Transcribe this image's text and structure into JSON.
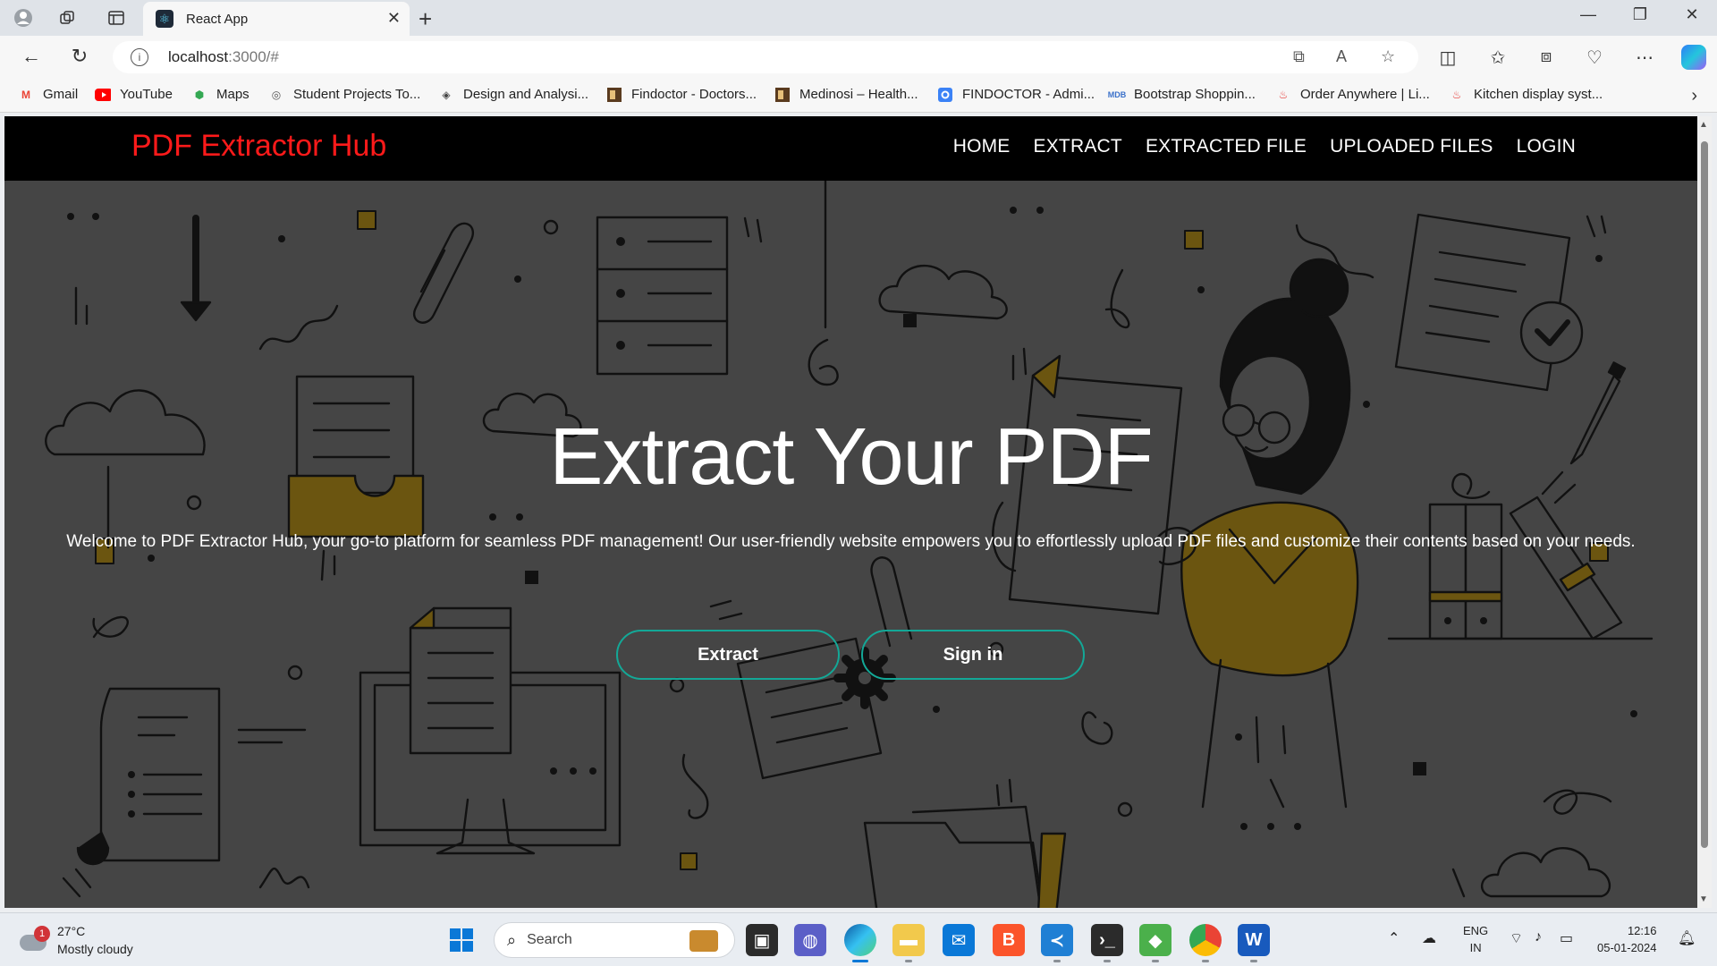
{
  "browser": {
    "tab_title": "React App",
    "url_host": "localhost",
    "url_rest": ":3000/#",
    "bookmarks": [
      {
        "label": "Gmail",
        "icon": "gmail-icon",
        "color": "#ea4335"
      },
      {
        "label": "YouTube",
        "icon": "youtube-icon",
        "color": "#ff0000"
      },
      {
        "label": "Maps",
        "icon": "maps-icon",
        "color": "#34a853"
      },
      {
        "label": "Student Projects To...",
        "icon": "globe-icon",
        "color": "#555555"
      },
      {
        "label": "Design and Analysi...",
        "icon": "diamond-icon",
        "color": "#444444"
      },
      {
        "label": "Findoctor - Doctors...",
        "icon": "site-icon",
        "color": "#5a3b1f"
      },
      {
        "label": "Medinosi – Health...",
        "icon": "site-icon",
        "color": "#5a3b1f"
      },
      {
        "label": "FINDOCTOR - Admi...",
        "icon": "gear-site-icon",
        "color": "#3b82f6"
      },
      {
        "label": "Bootstrap Shoppin...",
        "icon": "mdb-icon",
        "color": "#3b71ca"
      },
      {
        "label": "Order Anywhere | Li...",
        "icon": "flame-icon",
        "color": "#e53935"
      },
      {
        "label": "Kitchen display syst...",
        "icon": "flame-icon",
        "color": "#e53935"
      }
    ]
  },
  "site": {
    "brand": "PDF Extractor Hub",
    "nav": [
      "HOME",
      "EXTRACT",
      "EXTRACTED FILE",
      "UPLOADED FILES",
      "LOGIN"
    ],
    "hero_title": "Extract Your PDF",
    "hero_description": "Welcome to PDF Extractor Hub, your go-to platform for seamless PDF management! Our user-friendly website empowers you to effortlessly upload PDF files and customize their contents based on your needs.",
    "buttons": {
      "extract": "Extract",
      "signin": "Sign in"
    },
    "colors": {
      "brand": "#ff1a1a",
      "navbar_bg": "#000000",
      "hero_bg": "#454545",
      "button_border": "#13a897",
      "accent_mustard": "#6b5510"
    }
  },
  "taskbar": {
    "weather_temp": "27°C",
    "weather_desc": "Mostly cloudy",
    "weather_badge": "1",
    "search_placeholder": "Search",
    "lang_top": "ENG",
    "lang_bottom": "IN",
    "time": "12:16",
    "date": "05-01-2024"
  }
}
